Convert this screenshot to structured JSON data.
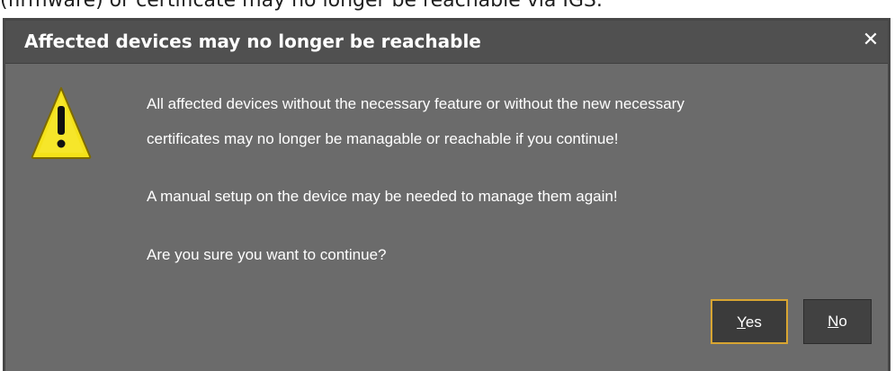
{
  "background": {
    "partial_text": "(firmware) or certificate may no longer be reachable via IGS."
  },
  "dialog": {
    "title": "Affected devices may no longer be reachable",
    "close_glyph": "✕",
    "icon": "warning-triangle-icon",
    "message_lines": [
      "All affected devices without the necessary feature or without the new necessary",
      "certificates may no longer be managable or reachable if you continue!",
      "A manual setup on the device may be needed to manage them again!",
      "Are you sure you want to continue?"
    ],
    "buttons": {
      "yes": {
        "mnemonic": "Y",
        "rest": "es"
      },
      "no": {
        "mnemonic": "N",
        "rest": "o"
      }
    },
    "colors": {
      "body": "#6b6b6b",
      "titlebar": "#505050",
      "button": "#3f3f3f",
      "focus_border": "#d8a532",
      "warning_fill": "#f4e21a"
    }
  }
}
